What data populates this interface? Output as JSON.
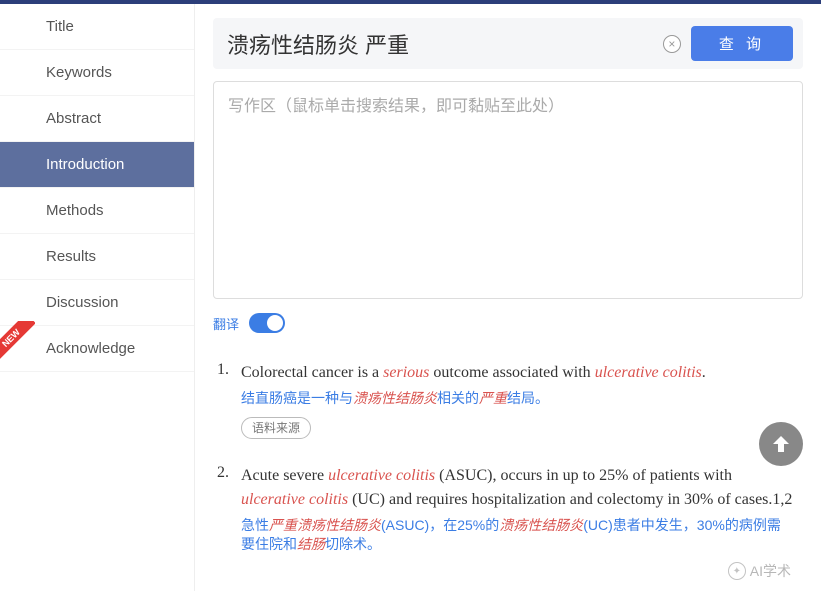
{
  "sidebar": {
    "items": [
      {
        "label": "Title"
      },
      {
        "label": "Keywords"
      },
      {
        "label": "Abstract"
      },
      {
        "label": "Introduction"
      },
      {
        "label": "Methods"
      },
      {
        "label": "Results"
      },
      {
        "label": "Discussion"
      },
      {
        "label": "Acknowledge"
      }
    ],
    "new_text": "NEW"
  },
  "search": {
    "value": "溃疡性结肠炎 严重",
    "clear_symbol": "×",
    "query_label": "查 询"
  },
  "write_area": {
    "placeholder": "写作区（鼠标单击搜索结果，即可黏贴至此处）"
  },
  "translate": {
    "label": "翻译",
    "on": true
  },
  "results": [
    {
      "num": "1.",
      "en_parts": [
        "Colorectal cancer is a ",
        "serious",
        " outcome associated with ",
        "ulcerative colitis",
        "."
      ],
      "zh_parts": [
        "结直肠癌是一种与",
        "溃疡性结肠炎",
        "相关的",
        "严重",
        "结局。"
      ],
      "source_label": "语料来源"
    },
    {
      "num": "2.",
      "en_parts": [
        "Acute severe ",
        "ulcerative colitis",
        " (ASUC), occurs in up to 25% of patients with ",
        "ulcerative colitis",
        " (UC) and requires hospitalization and colectomy in 30% of cases.1,2"
      ],
      "zh_parts": [
        "急性",
        "严重溃疡性结肠炎",
        "(ASUC)，在25%的",
        "溃疡性结肠炎",
        "(UC)患者中发生，30%的病例需要住院和",
        "结肠",
        "切除术。"
      ]
    }
  ],
  "watermark": {
    "text": "AI学术"
  }
}
